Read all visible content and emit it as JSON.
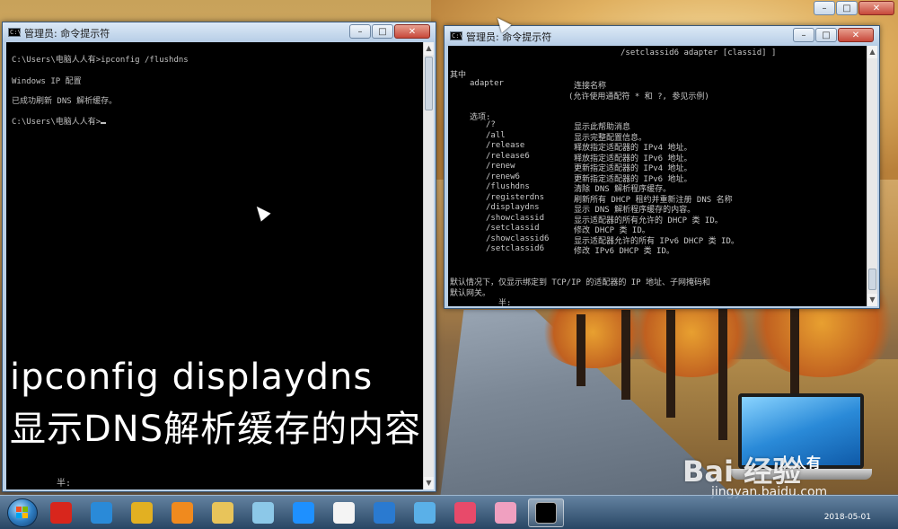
{
  "left_window": {
    "title": "管理员: 命令提示符",
    "lines": [
      "C:\\Users\\电脑人人有>ipconfig /flushdns",
      "Windows IP 配置",
      "已成功刷新 DNS 解析缓存。",
      "C:\\Users\\电脑人人有>"
    ],
    "overlay_command": "ipconfig displaydns",
    "overlay_description": "显示DNS解析缓存的内容",
    "ime_status": "半:"
  },
  "right_window": {
    "title": "管理员: 命令提示符",
    "top_line": "/setclassid6 adapter [classid] ]",
    "where_label": "其中",
    "adapter_name": "adapter",
    "adapter_desc1": "连接名称",
    "adapter_desc2": "(允许使用通配符 * 和 ?, 参见示例)",
    "options_label": "选项:",
    "options": [
      {
        "flag": "/?",
        "desc": "显示此帮助消息"
      },
      {
        "flag": "/all",
        "desc": "显示完整配置信息。"
      },
      {
        "flag": "/release",
        "desc": "释放指定适配器的 IPv4 地址。"
      },
      {
        "flag": "/release6",
        "desc": "释放指定适配器的 IPv6 地址。"
      },
      {
        "flag": "/renew",
        "desc": "更新指定适配器的 IPv4 地址。"
      },
      {
        "flag": "/renew6",
        "desc": "更新指定适配器的 IPv6 地址。"
      },
      {
        "flag": "/flushdns",
        "desc": "清除 DNS 解析程序缓存。"
      },
      {
        "flag": "/registerdns",
        "desc": "刷新所有 DHCP 租约并重新注册 DNS 名称"
      },
      {
        "flag": "/displaydns",
        "desc": "显示 DNS 解析程序缓存的内容。"
      },
      {
        "flag": "/showclassid",
        "desc": "显示适配器的所有允许的 DHCP 类 ID。"
      },
      {
        "flag": "/setclassid",
        "desc": "修改 DHCP 类 ID。"
      },
      {
        "flag": "/showclassid6",
        "desc": "显示适配器允许的所有 IPv6 DHCP 类 ID。"
      },
      {
        "flag": "/setclassid6",
        "desc": "修改 IPv6 DHCP 类 ID。"
      }
    ],
    "default_line1": "默认情况下，仅显示绑定到 TCP/IP 的适配器的 IP 地址、子网掩码和",
    "default_line2": "默认网关。",
    "ime_status": "半:"
  },
  "caption_buttons": {
    "minimize": "–",
    "maximize": "□",
    "close": "✕"
  },
  "watermark": {
    "brand": "Bai 经验",
    "url": "jingyan.baidu.com"
  },
  "laptop_brand": "人人有",
  "taskbar": {
    "clock_date": "2018-05-01",
    "items": [
      {
        "name": "taskbar-app-360",
        "color": "#d8261c"
      },
      {
        "name": "taskbar-app-ie",
        "color": "#2a8ad8"
      },
      {
        "name": "taskbar-app-chrome",
        "color": "#e2b022"
      },
      {
        "name": "taskbar-app-media",
        "color": "#f08a1e"
      },
      {
        "name": "taskbar-app-explorer",
        "color": "#e8c45a"
      },
      {
        "name": "taskbar-app-folder",
        "color": "#8cc8e8"
      },
      {
        "name": "taskbar-app-browser",
        "color": "#1e90ff"
      },
      {
        "name": "taskbar-app-doc",
        "color": "#f4f4f4"
      },
      {
        "name": "taskbar-app-remote",
        "color": "#2a7ad0"
      },
      {
        "name": "taskbar-app-tool",
        "color": "#5ab0e8"
      },
      {
        "name": "taskbar-app-paint",
        "color": "#e84a6a"
      },
      {
        "name": "taskbar-app-qq",
        "color": "#f0a0c0"
      },
      {
        "name": "taskbar-app-cmd",
        "color": "#000000"
      }
    ]
  }
}
